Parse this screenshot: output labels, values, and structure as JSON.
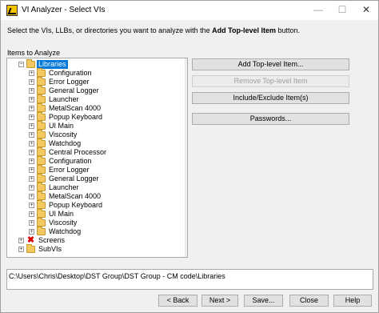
{
  "window": {
    "title": "VI Analyzer - Select VIs",
    "minimize": "—",
    "maximize": "☐",
    "close": "✕"
  },
  "instructions": {
    "prefix": "Select the VIs, LLBs, or directories you want to analyze with the ",
    "bold": "Add Top-level Item",
    "suffix": " button."
  },
  "items_label": "Items to Analyze",
  "tree": [
    {
      "label": "Libraries",
      "icon": "folder-icon",
      "expander": "−",
      "selected": true
    },
    {
      "label": "Configuration",
      "icon": "folder-icon",
      "expander": "+"
    },
    {
      "label": "Error Logger",
      "icon": "folder-icon",
      "expander": "+"
    },
    {
      "label": "General Logger",
      "icon": "folder-icon",
      "expander": "+"
    },
    {
      "label": "Launcher",
      "icon": "folder-icon",
      "expander": "+"
    },
    {
      "label": "MetalScan 4000",
      "icon": "folder-icon",
      "expander": "+"
    },
    {
      "label": "Popup Keyboard",
      "icon": "folder-icon",
      "expander": "+"
    },
    {
      "label": "UI Main",
      "icon": "folder-icon",
      "expander": "+"
    },
    {
      "label": "Viscosity",
      "icon": "folder-icon",
      "expander": "+"
    },
    {
      "label": "Watchdog",
      "icon": "folder-icon",
      "expander": "+"
    },
    {
      "label": "Central Processor",
      "icon": "folder-icon",
      "expander": "+"
    },
    {
      "label": "Configuration",
      "icon": "folder-icon",
      "expander": "+"
    },
    {
      "label": "Error Logger",
      "icon": "folder-icon",
      "expander": "+"
    },
    {
      "label": "General Logger",
      "icon": "folder-icon",
      "expander": "+"
    },
    {
      "label": "Launcher",
      "icon": "folder-icon",
      "expander": "+"
    },
    {
      "label": "MetalScan 4000",
      "icon": "folder-icon",
      "expander": "+"
    },
    {
      "label": "Popup Keyboard",
      "icon": "folder-icon",
      "expander": "+"
    },
    {
      "label": "UI Main",
      "icon": "folder-icon",
      "expander": "+"
    },
    {
      "label": "Viscosity",
      "icon": "folder-icon",
      "expander": "+"
    },
    {
      "label": "Watchdog",
      "icon": "folder-icon",
      "expander": "+"
    },
    {
      "label": "Screens",
      "icon": "excluded-icon",
      "expander": "+"
    },
    {
      "label": "SubVIs",
      "icon": "folder-icon",
      "expander": "+"
    }
  ],
  "side_buttons": {
    "add": "Add Top-level Item...",
    "remove": "Remove Top-level Item",
    "include_exclude": "Include/Exclude Item(s)",
    "passwords": "Passwords..."
  },
  "path": "C:\\Users\\Chris\\Desktop\\DST Group\\DST Group - CM code\\Libraries",
  "bottom_buttons": {
    "back": "< Back",
    "next": "Next >",
    "save": "Save...",
    "close": "Close",
    "help": "Help"
  },
  "scroll": {
    "up": "▲",
    "down": "▼"
  }
}
